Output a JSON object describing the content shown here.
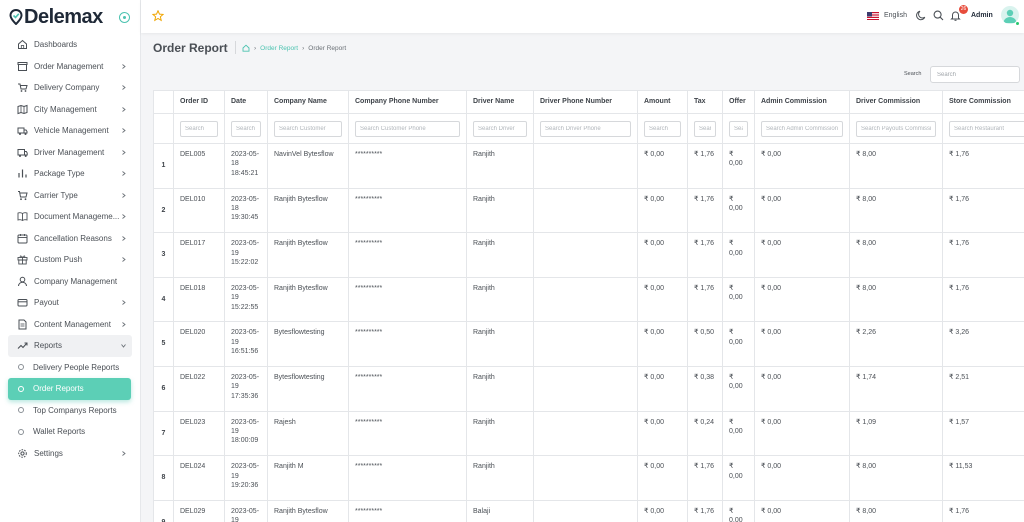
{
  "brand": {
    "name": "Delemax",
    "accent": "#4cc3b0"
  },
  "sidebar": {
    "items": [
      {
        "label": "Dashboards",
        "icon": "home-icon",
        "chevron": false
      },
      {
        "label": "Order Management",
        "icon": "box-icon",
        "chevron": true
      },
      {
        "label": "Delivery Company",
        "icon": "truck-icon",
        "chevron": true
      },
      {
        "label": "City Management",
        "icon": "map-icon",
        "chevron": true
      },
      {
        "label": "Vehicle Management",
        "icon": "vehicle-icon",
        "chevron": true
      },
      {
        "label": "Driver Management",
        "icon": "driver-truck-icon",
        "chevron": true
      },
      {
        "label": "Package Type",
        "icon": "bar-chart-icon",
        "chevron": true
      },
      {
        "label": "Carrier Type",
        "icon": "cart-icon",
        "chevron": true
      },
      {
        "label": "Document Manageme...",
        "icon": "book-icon",
        "chevron": true
      },
      {
        "label": "Cancellation Reasons",
        "icon": "calendar-icon",
        "chevron": true
      },
      {
        "label": "Custom Push",
        "icon": "gift-icon",
        "chevron": true
      },
      {
        "label": "Company Management",
        "icon": "user-icon",
        "chevron": false
      },
      {
        "label": "Payout",
        "icon": "card-icon",
        "chevron": true
      },
      {
        "label": "Content Management",
        "icon": "document-icon",
        "chevron": true
      },
      {
        "label": "Reports",
        "icon": "trend-icon",
        "chevron": true,
        "open": true
      }
    ],
    "report_subitems": [
      {
        "label": "Delivery People Reports",
        "active": false
      },
      {
        "label": "Order Reports",
        "active": true
      },
      {
        "label": "Top Companys Reports",
        "active": false
      },
      {
        "label": "Wallet Reports",
        "active": false
      }
    ],
    "settings": {
      "label": "Settings",
      "icon": "settings-icon"
    }
  },
  "topbar": {
    "language": "English",
    "notification_count": "26",
    "user": "Admin"
  },
  "page": {
    "title": "Order Report",
    "breadcrumb": {
      "link": "Order Report",
      "current": "Order Report"
    },
    "search_label": "Search",
    "search_placeholder": "Search"
  },
  "table": {
    "columns": [
      {
        "key": "row",
        "label": "",
        "filter": null
      },
      {
        "key": "order_id",
        "label": "Order ID",
        "filter": "Search"
      },
      {
        "key": "date",
        "label": "Date",
        "filter": "Search"
      },
      {
        "key": "company",
        "label": "Company Name",
        "filter": "Search Customer"
      },
      {
        "key": "company_phone",
        "label": "Company Phone Number",
        "filter": "Search Customer Phone"
      },
      {
        "key": "driver",
        "label": "Driver Name",
        "filter": "Search Driver"
      },
      {
        "key": "driver_phone",
        "label": "Driver Phone Number",
        "filter": "Search Driver Phone"
      },
      {
        "key": "amount",
        "label": "Amount",
        "filter": "Search"
      },
      {
        "key": "tax",
        "label": "Tax",
        "filter": "Search"
      },
      {
        "key": "offer",
        "label": "Offer",
        "filter": "Search"
      },
      {
        "key": "admin_commission",
        "label": "Admin Commission",
        "filter": "Search Admin Commission"
      },
      {
        "key": "driver_commission",
        "label": "Driver Commission",
        "filter": "Search Payouts Commission"
      },
      {
        "key": "store_commission",
        "label": "Store Commission",
        "filter": "Search Restaurant"
      }
    ],
    "rows": [
      {
        "row": "1",
        "order_id": "DEL005",
        "date": "2023-05-18 18:45:21",
        "company": "NavinVel Bytesflow",
        "company_phone": "**********",
        "driver": "Ranjith",
        "driver_phone": "",
        "amount": "₹ 0,00",
        "tax": "₹ 1,76",
        "offer": "₹ 0,00",
        "admin_commission": "₹ 0,00",
        "driver_commission": "₹ 8,00",
        "store_commission": "₹ 1,76"
      },
      {
        "row": "2",
        "order_id": "DEL010",
        "date": "2023-05-18 19:30:45",
        "company": "Ranjith Bytesflow",
        "company_phone": "**********",
        "driver": "Ranjith",
        "driver_phone": "",
        "amount": "₹ 0,00",
        "tax": "₹ 1,76",
        "offer": "₹ 0,00",
        "admin_commission": "₹ 0,00",
        "driver_commission": "₹ 8,00",
        "store_commission": "₹ 1,76"
      },
      {
        "row": "3",
        "order_id": "DEL017",
        "date": "2023-05-19 15:22:02",
        "company": "Ranjith Bytesflow",
        "company_phone": "**********",
        "driver": "Ranjith",
        "driver_phone": "",
        "amount": "₹ 0,00",
        "tax": "₹ 1,76",
        "offer": "₹ 0,00",
        "admin_commission": "₹ 0,00",
        "driver_commission": "₹ 8,00",
        "store_commission": "₹ 1,76"
      },
      {
        "row": "4",
        "order_id": "DEL018",
        "date": "2023-05-19 15:22:55",
        "company": "Ranjith Bytesflow",
        "company_phone": "**********",
        "driver": "Ranjith",
        "driver_phone": "",
        "amount": "₹ 0,00",
        "tax": "₹ 1,76",
        "offer": "₹ 0,00",
        "admin_commission": "₹ 0,00",
        "driver_commission": "₹ 8,00",
        "store_commission": "₹ 1,76"
      },
      {
        "row": "5",
        "order_id": "DEL020",
        "date": "2023-05-19 16:51:56",
        "company": "Bytesflowtesting",
        "company_phone": "**********",
        "driver": "Ranjith",
        "driver_phone": "",
        "amount": "₹ 0,00",
        "tax": "₹ 0,50",
        "offer": "₹ 0,00",
        "admin_commission": "₹ 0,00",
        "driver_commission": "₹ 2,26",
        "store_commission": "₹ 3,26"
      },
      {
        "row": "6",
        "order_id": "DEL022",
        "date": "2023-05-19 17:35:36",
        "company": "Bytesflowtesting",
        "company_phone": "**********",
        "driver": "Ranjith",
        "driver_phone": "",
        "amount": "₹ 0,00",
        "tax": "₹ 0,38",
        "offer": "₹ 0,00",
        "admin_commission": "₹ 0,00",
        "driver_commission": "₹ 1,74",
        "store_commission": "₹ 2,51"
      },
      {
        "row": "7",
        "order_id": "DEL023",
        "date": "2023-05-19 18:00:09",
        "company": "Rajesh",
        "company_phone": "**********",
        "driver": "Ranjith",
        "driver_phone": "",
        "amount": "₹ 0,00",
        "tax": "₹ 0,24",
        "offer": "₹ 0,00",
        "admin_commission": "₹ 0,00",
        "driver_commission": "₹ 1,09",
        "store_commission": "₹ 1,57"
      },
      {
        "row": "8",
        "order_id": "DEL024",
        "date": "2023-05-19 19:20:36",
        "company": "Ranjith M",
        "company_phone": "**********",
        "driver": "Ranjith",
        "driver_phone": "",
        "amount": "₹ 0,00",
        "tax": "₹ 1,76",
        "offer": "₹ 0,00",
        "admin_commission": "₹ 0,00",
        "driver_commission": "₹ 8,00",
        "store_commission": "₹ 11,53"
      },
      {
        "row": "9",
        "order_id": "DEL029",
        "date": "2023-05-19",
        "company": "Ranjith Bytesflow",
        "company_phone": "**********",
        "driver": "Balaji",
        "driver_phone": "",
        "amount": "₹ 0,00",
        "tax": "₹ 1,76",
        "offer": "₹ 0,00",
        "admin_commission": "₹ 0,00",
        "driver_commission": "₹ 8,00",
        "store_commission": "₹ 1,76"
      }
    ]
  }
}
